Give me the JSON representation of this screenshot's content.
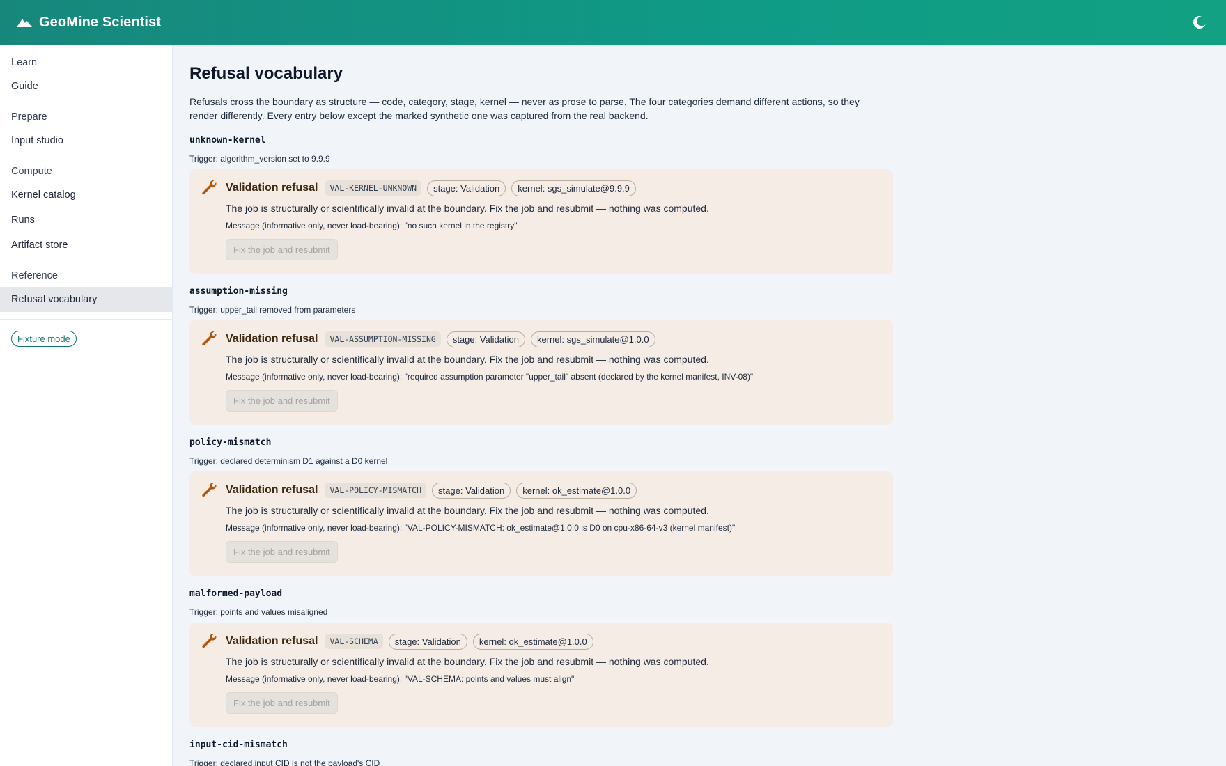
{
  "app": {
    "title": "GeoMine Scientist",
    "logo_icon": "mountain-icon",
    "theme_toggle_icon": "moon-icon"
  },
  "sidebar": {
    "groups": [
      {
        "section": "Learn",
        "items": [
          {
            "label": "Guide",
            "active": false
          }
        ]
      },
      {
        "section": "Prepare",
        "items": [
          {
            "label": "Input studio",
            "active": false
          }
        ]
      },
      {
        "section": "Compute",
        "items": [
          {
            "label": "Kernel catalog",
            "active": false
          },
          {
            "label": "Runs",
            "active": false
          },
          {
            "label": "Artifact store",
            "active": false
          }
        ]
      },
      {
        "section": "Reference",
        "items": [
          {
            "label": "Refusal vocabulary",
            "active": true
          }
        ]
      }
    ],
    "fixture_mode": "Fixture mode"
  },
  "page": {
    "title": "Refusal vocabulary",
    "intro": "Refusals cross the boundary as structure — code, category, stage, kernel — never as prose to parse. The four categories demand different actions, so they render differently. Every entry below except the marked synthetic one was captured from the real backend."
  },
  "entries": [
    {
      "id": "unknown-kernel",
      "trigger": "Trigger: algorithm_version set to 9.9.9",
      "category": "Validation refusal",
      "code": "VAL-KERNEL-UNKNOWN",
      "stage": "stage: Validation",
      "kernel": "kernel: sgs_simulate@9.9.9",
      "description": "The job is structurally or scientifically invalid at the boundary. Fix the job and resubmit — nothing was computed.",
      "message": "Message (informative only, never load-bearing): \"no such kernel in the registry\"",
      "action": "Fix the job and resubmit"
    },
    {
      "id": "assumption-missing",
      "trigger": "Trigger: upper_tail removed from parameters",
      "category": "Validation refusal",
      "code": "VAL-ASSUMPTION-MISSING",
      "stage": "stage: Validation",
      "kernel": "kernel: sgs_simulate@1.0.0",
      "description": "The job is structurally or scientifically invalid at the boundary. Fix the job and resubmit — nothing was computed.",
      "message": "Message (informative only, never load-bearing): \"required assumption parameter \"upper_tail\" absent (declared by the kernel manifest, INV-08)\"",
      "action": "Fix the job and resubmit"
    },
    {
      "id": "policy-mismatch",
      "trigger": "Trigger: declared determinism D1 against a D0 kernel",
      "category": "Validation refusal",
      "code": "VAL-POLICY-MISMATCH",
      "stage": "stage: Validation",
      "kernel": "kernel: ok_estimate@1.0.0",
      "description": "The job is structurally or scientifically invalid at the boundary. Fix the job and resubmit — nothing was computed.",
      "message": "Message (informative only, never load-bearing): \"VAL-POLICY-MISMATCH: ok_estimate@1.0.0 is D0 on cpu-x86-64-v3 (kernel manifest)\"",
      "action": "Fix the job and resubmit"
    },
    {
      "id": "malformed-payload",
      "trigger": "Trigger: points and values misaligned",
      "category": "Validation refusal",
      "code": "VAL-SCHEMA",
      "stage": "stage: Validation",
      "kernel": "kernel: ok_estimate@1.0.0",
      "description": "The job is structurally or scientifically invalid at the boundary. Fix the job and resubmit — nothing was computed.",
      "message": "Message (informative only, never load-bearing): \"VAL-SCHEMA: points and values must align\"",
      "action": "Fix the job and resubmit"
    },
    {
      "id": "input-cid-mismatch",
      "trigger": "Trigger: declared input CID is not the payload's CID"
    }
  ]
}
